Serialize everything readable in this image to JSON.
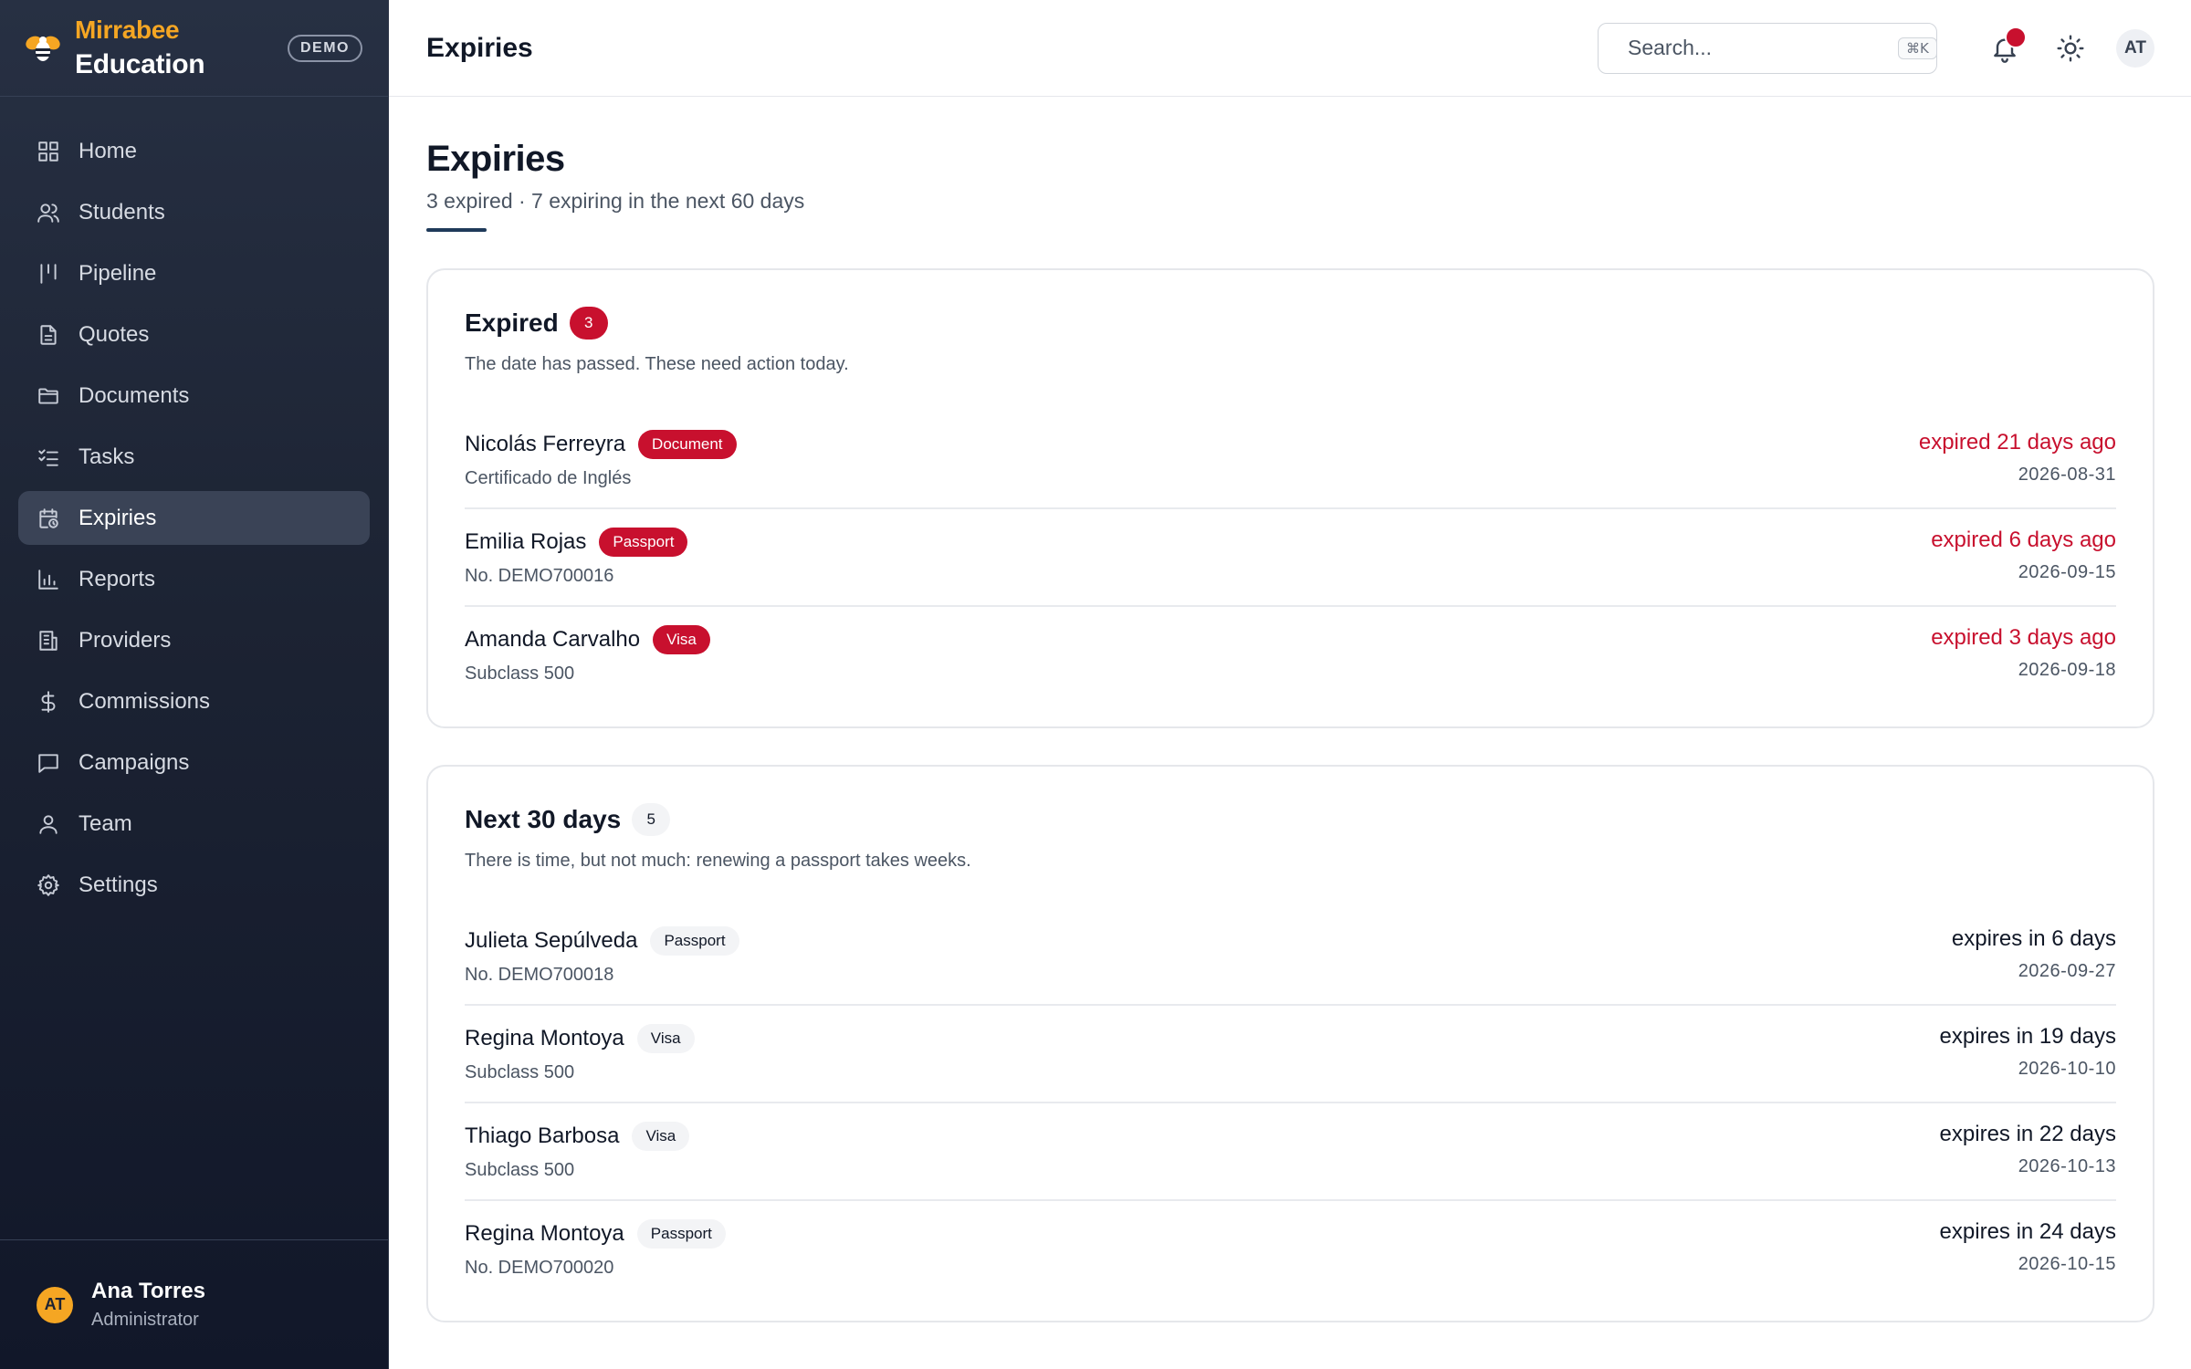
{
  "brand": {
    "name": "Mirrabee",
    "sub": "Education",
    "badge": "DEMO",
    "accent": "#f5a623"
  },
  "sidebar": {
    "items": [
      {
        "label": "Home",
        "icon": "grid-icon",
        "active": false
      },
      {
        "label": "Students",
        "icon": "users-icon",
        "active": false
      },
      {
        "label": "Pipeline",
        "icon": "pipeline-icon",
        "active": false
      },
      {
        "label": "Quotes",
        "icon": "file-text-icon",
        "active": false
      },
      {
        "label": "Documents",
        "icon": "folder-icon",
        "active": false
      },
      {
        "label": "Tasks",
        "icon": "checklist-icon",
        "active": false
      },
      {
        "label": "Expiries",
        "icon": "calendar-clock-icon",
        "active": true
      },
      {
        "label": "Reports",
        "icon": "bar-chart-icon",
        "active": false
      },
      {
        "label": "Providers",
        "icon": "building-icon",
        "active": false
      },
      {
        "label": "Commissions",
        "icon": "dollar-icon",
        "active": false
      },
      {
        "label": "Campaigns",
        "icon": "message-icon",
        "active": false
      },
      {
        "label": "Team",
        "icon": "user-icon",
        "active": false
      },
      {
        "label": "Settings",
        "icon": "gear-icon",
        "active": false
      }
    ],
    "user": {
      "initials": "AT",
      "name": "Ana Torres",
      "role": "Administrator"
    }
  },
  "topbar": {
    "title": "Expiries",
    "search_placeholder": "Search...",
    "search_shortcut": "⌘K",
    "avatar_initials": "AT",
    "notification_color": "#c8102e"
  },
  "page": {
    "title": "Expiries",
    "subtitle": "3 expired · 7 expiring in the next 60 days"
  },
  "sections": [
    {
      "title": "Expired",
      "count": "3",
      "tone": "red",
      "description": "The date has passed. These need action today.",
      "rows": [
        {
          "name": "Nicolás Ferreyra",
          "tag": "Document",
          "detail": "Certificado de Inglés",
          "status": "expired 21 days ago",
          "date": "2026-08-31"
        },
        {
          "name": "Emilia Rojas",
          "tag": "Passport",
          "detail": "No. DEMO700016",
          "status": "expired 6 days ago",
          "date": "2026-09-15"
        },
        {
          "name": "Amanda Carvalho",
          "tag": "Visa",
          "detail": "Subclass 500",
          "status": "expired 3 days ago",
          "date": "2026-09-18"
        }
      ]
    },
    {
      "title": "Next 30 days",
      "count": "5",
      "tone": "gray",
      "description": "There is time, but not much: renewing a passport takes weeks.",
      "rows": [
        {
          "name": "Julieta Sepúlveda",
          "tag": "Passport",
          "detail": "No. DEMO700018",
          "status": "expires in 6 days",
          "date": "2026-09-27"
        },
        {
          "name": "Regina Montoya",
          "tag": "Visa",
          "detail": "Subclass 500",
          "status": "expires in 19 days",
          "date": "2026-10-10"
        },
        {
          "name": "Thiago Barbosa",
          "tag": "Visa",
          "detail": "Subclass 500",
          "status": "expires in 22 days",
          "date": "2026-10-13"
        },
        {
          "name": "Regina Montoya",
          "tag": "Passport",
          "detail": "No. DEMO700020",
          "status": "expires in 24 days",
          "date": "2026-10-15"
        }
      ]
    }
  ]
}
